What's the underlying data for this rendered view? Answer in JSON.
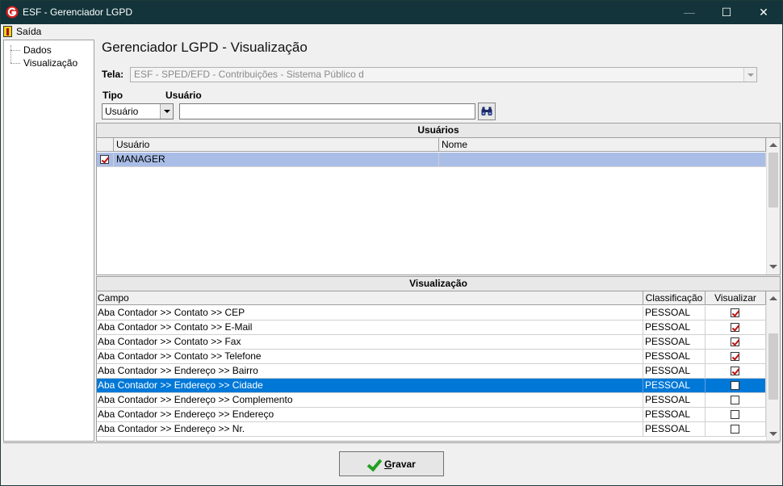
{
  "window": {
    "title": "ESF - Gerenciador LGPD",
    "minimize_glyph": "—",
    "maximize_glyph": "☐",
    "close_glyph": "✕"
  },
  "menu": {
    "exit_label": "Saída"
  },
  "tree": {
    "items": [
      "Dados",
      "Visualização"
    ]
  },
  "main": {
    "title": "Gerenciador LGPD - Visualização",
    "tela_label": "Tela:",
    "tela_value": "ESF - SPED/EFD - Contribuições - Sistema Público d",
    "tipo_label": "Tipo",
    "usuario_label": "Usuário",
    "tipo_value": "Usuário",
    "usuario_value": ""
  },
  "users_panel": {
    "title": "Usuários",
    "columns": [
      "Usuário",
      "Nome"
    ],
    "rows": [
      {
        "checked": true,
        "usuario": "MANAGER",
        "nome": ""
      }
    ]
  },
  "visual_panel": {
    "title": "Visualização",
    "columns": [
      "Campo",
      "Classificação",
      "Visualizar"
    ],
    "rows": [
      {
        "campo": "Aba Contador >> Contato >> CEP",
        "classificacao": "PESSOAL",
        "visualizar": true
      },
      {
        "campo": "Aba Contador >> Contato >> E-Mail",
        "classificacao": "PESSOAL",
        "visualizar": true
      },
      {
        "campo": "Aba Contador >> Contato >> Fax",
        "classificacao": "PESSOAL",
        "visualizar": true
      },
      {
        "campo": "Aba Contador >> Contato >> Telefone",
        "classificacao": "PESSOAL",
        "visualizar": true
      },
      {
        "campo": "Aba Contador >> Endereço >> Bairro",
        "classificacao": "PESSOAL",
        "visualizar": true
      },
      {
        "campo": "Aba Contador >> Endereço >> Cidade",
        "classificacao": "PESSOAL",
        "visualizar": false
      },
      {
        "campo": "Aba Contador >> Endereço >> Complemento",
        "classificacao": "PESSOAL",
        "visualizar": false
      },
      {
        "campo": "Aba Contador >> Endereço >> Endereço",
        "classificacao": "PESSOAL",
        "visualizar": false
      },
      {
        "campo": "Aba Contador >> Endereço >> Nr.",
        "classificacao": "PESSOAL",
        "visualizar": false
      }
    ],
    "selected_index": 5
  },
  "footer": {
    "gravar_first": "G",
    "gravar_rest": "ravar"
  },
  "colors": {
    "titlebar": "#12343a",
    "selected_row": "#0078d7",
    "users_selected_row": "#a9bde6",
    "check_mark": "#c01010",
    "gravar_check": "#22a022"
  }
}
